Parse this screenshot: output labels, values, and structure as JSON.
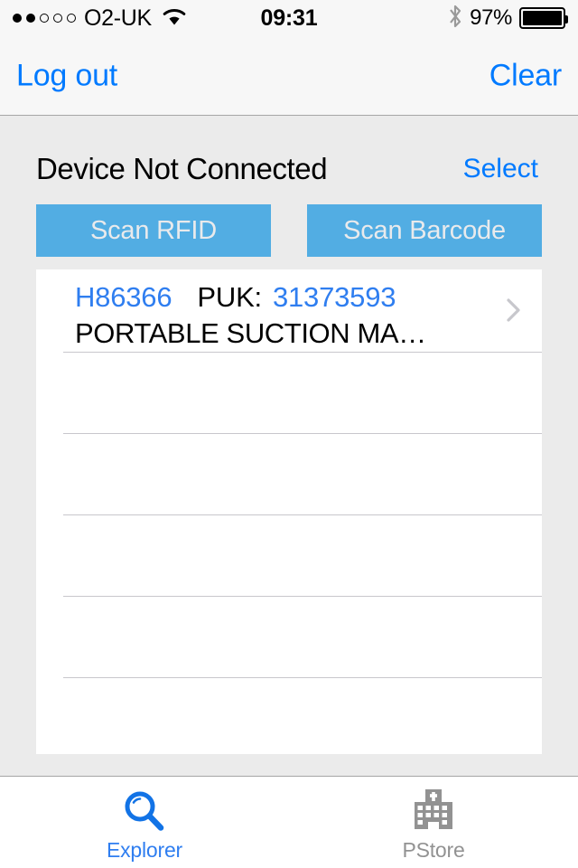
{
  "status_bar": {
    "signal_dots_filled": 2,
    "signal_dots_empty": 3,
    "carrier": "O2-UK",
    "wifi_icon": "wifi-icon",
    "time": "09:31",
    "bluetooth_icon": "bluetooth-icon",
    "battery_percent": "97%",
    "battery_icon": "battery-icon"
  },
  "nav_bar": {
    "left_button": "Log out",
    "right_button": "Clear"
  },
  "device": {
    "status_text": "Device Not Connected",
    "select_button": "Select"
  },
  "scan": {
    "rfid_button": "Scan RFID",
    "barcode_button": "Scan Barcode"
  },
  "list": {
    "rows": [
      {
        "code": "H86366",
        "puk_label": "PUK:",
        "puk_value": "31373593",
        "description": "PORTABLE SUCTION MA…",
        "disclosure_icon": "chevron-right-icon"
      }
    ],
    "empty_row_count": 5
  },
  "tab_bar": {
    "tabs": [
      {
        "label": "Explorer",
        "icon": "magnifier-icon",
        "active": true
      },
      {
        "label": "PStore",
        "icon": "hospital-icon",
        "active": false
      }
    ]
  },
  "colors": {
    "ios_blue": "#007aff",
    "link_blue": "#2f7ef0",
    "scan_button_blue": "#52ade3",
    "background_gray": "#ebebeb",
    "bar_gray": "#f7f7f7",
    "inactive_gray": "#929292",
    "separator": "#c8c7cc"
  }
}
